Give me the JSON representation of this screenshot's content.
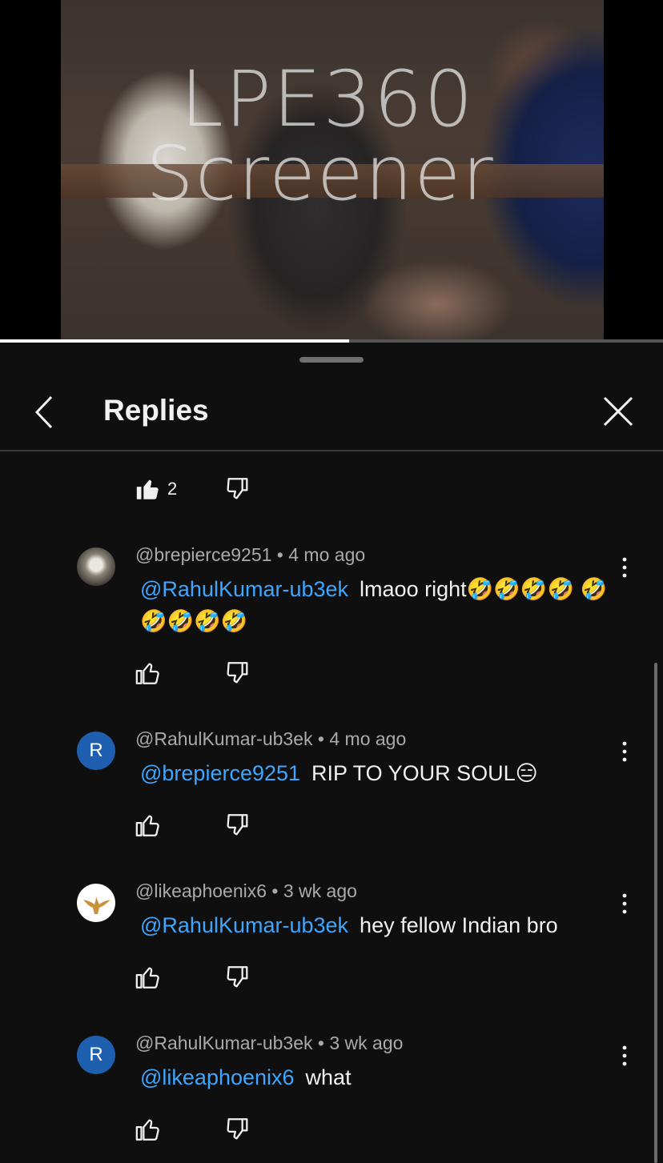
{
  "video": {
    "watermark_line1": "LPE360",
    "watermark_line2": "Screener",
    "progress_fraction": 0.527
  },
  "header": {
    "title": "Replies",
    "back_icon": "chevron-left-icon",
    "close_icon": "close-icon"
  },
  "parent_actions": {
    "like_count": "2"
  },
  "comments": [
    {
      "author": "@brepierce9251",
      "time": "4 mo ago",
      "mention": "@RahulKumar-ub3ek",
      "text": "lmaoo right🤣🤣🤣🤣 🤣🤣🤣🤣🤣",
      "avatar": "photo"
    },
    {
      "author": "@RahulKumar-ub3ek",
      "time": "4 mo ago",
      "mention": "@brepierce9251",
      "text": "RIP TO YOUR SOUL😑",
      "avatar": "R"
    },
    {
      "author": "@likeaphoenix6",
      "time": "3 wk ago",
      "mention": "@RahulKumar-ub3ek",
      "text": "hey fellow Indian bro",
      "avatar": "bird"
    },
    {
      "author": "@RahulKumar-ub3ek",
      "time": "3 wk ago",
      "mention": "@likeaphoenix6",
      "text": "what",
      "avatar": "R"
    }
  ],
  "separator": "•",
  "colors": {
    "background": "#0f0f0f",
    "mention": "#3ea6ff",
    "avatar_letter_bg": "#1f5fb0"
  }
}
